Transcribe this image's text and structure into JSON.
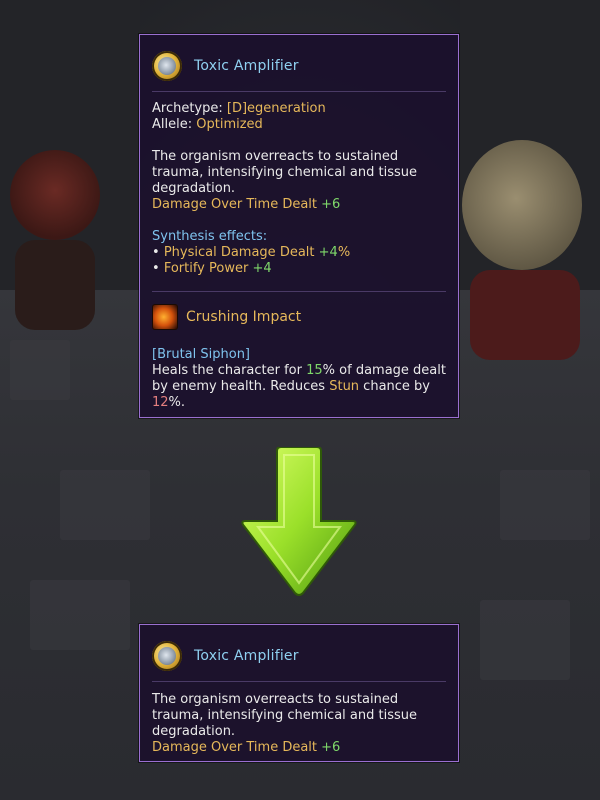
{
  "top_card": {
    "title": "Toxic Amplifier",
    "archetype_label": "Archetype: ",
    "archetype_value": "[D]egeneration",
    "allele_label": "Allele: ",
    "allele_value": "Optimized",
    "description_lines": [
      "The organism overreacts to sustained",
      "trauma, intensifying chemical and tissue",
      "degradation."
    ],
    "stat_label": "Damage Over Time Dealt ",
    "stat_value": "+6",
    "synthesis_title": "Synthesis effects:",
    "synthesis": [
      {
        "bullet": "• ",
        "label": "Physical Damage Dealt ",
        "value": "+4",
        "suffix": "%"
      },
      {
        "bullet": "• ",
        "label": "Fortify Power ",
        "value": "+4",
        "suffix": ""
      }
    ],
    "effect_title": "Crushing Impact",
    "effect_tag": "[Brutal Siphon]",
    "effect_text": {
      "p1": "Heals the character for ",
      "v1": "15",
      "p2": "% of damage dealt",
      "p3": "by enemy health. Reduces ",
      "v2": "Stun",
      "p4": " chance by",
      "v3": "12",
      "p5": "%."
    }
  },
  "bottom_card": {
    "title": "Toxic Amplifier",
    "description_lines": [
      "The organism overreacts to sustained",
      "trauma, intensifying chemical and tissue",
      "degradation."
    ],
    "stat_label": "Damage Over Time Dealt ",
    "stat_value": "+6"
  },
  "icons": {
    "item": "gear-orb-icon",
    "effect": "crushing-impact-icon",
    "arrow": "down-arrow-icon"
  },
  "colors": {
    "title": "#8fd0f0",
    "gold": "#e6b85a",
    "green": "#7fd86a",
    "red": "#e47f7f",
    "border": "#9a6fd0",
    "arrow": "#9be02a"
  }
}
